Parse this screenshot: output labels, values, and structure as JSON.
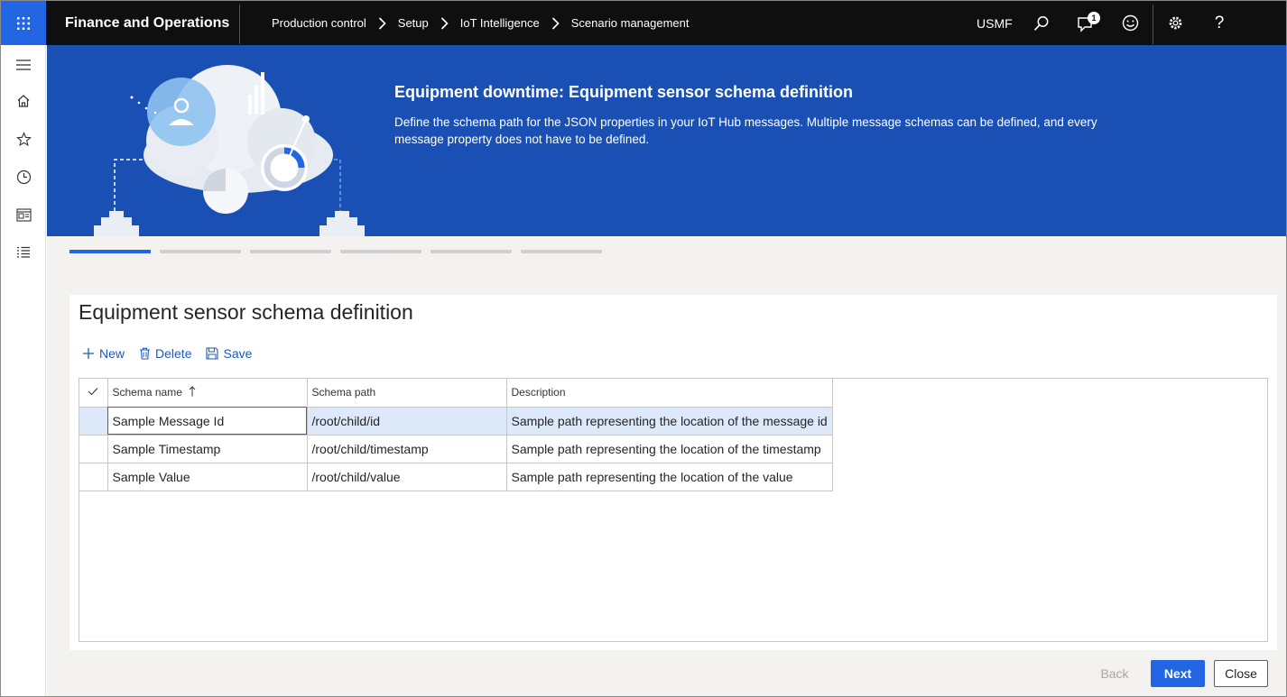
{
  "header": {
    "app_title": "Finance and Operations",
    "breadcrumbs": [
      "Production control",
      "Setup",
      "IoT Intelligence",
      "Scenario management"
    ],
    "company": "USMF",
    "notification_count": "1",
    "icons": [
      "waffle-icon",
      "search-icon",
      "notification-icon",
      "feedback-smiley-icon",
      "settings-gear-icon",
      "help-icon"
    ]
  },
  "leftnav": {
    "icons": [
      "hamburger-icon",
      "home-icon",
      "favorites-star-icon",
      "recent-clock-icon",
      "workspaces-icon",
      "modules-list-icon"
    ]
  },
  "hero": {
    "title": "Equipment downtime: Equipment sensor schema definition",
    "description": "Define the schema path for the JSON properties in your IoT Hub messages. Multiple message schemas can be defined, and every message property does not have to be defined."
  },
  "steps": {
    "total": 6,
    "current": 1
  },
  "card": {
    "title": "Equipment sensor schema definition",
    "actions": {
      "new": "New",
      "delete": "Delete",
      "save": "Save"
    },
    "grid": {
      "columns": [
        "Schema name",
        "Schema path",
        "Description"
      ],
      "rows": [
        {
          "name": "Sample Message Id",
          "path": "/root/child/id",
          "description": "Sample path representing the location of the message id"
        },
        {
          "name": "Sample Timestamp",
          "path": "/root/child/timestamp",
          "description": "Sample path representing the location of the timestamp"
        },
        {
          "name": "Sample Value",
          "path": "/root/child/value",
          "description": "Sample path representing the location of the value"
        }
      ]
    }
  },
  "footer": {
    "back": "Back",
    "next": "Next",
    "close": "Close"
  },
  "colors": {
    "accent": "#2266e3",
    "hero_bg": "#1a4fb4",
    "topbar_bg": "#0f0f0f",
    "link": "#1a5bbd"
  }
}
